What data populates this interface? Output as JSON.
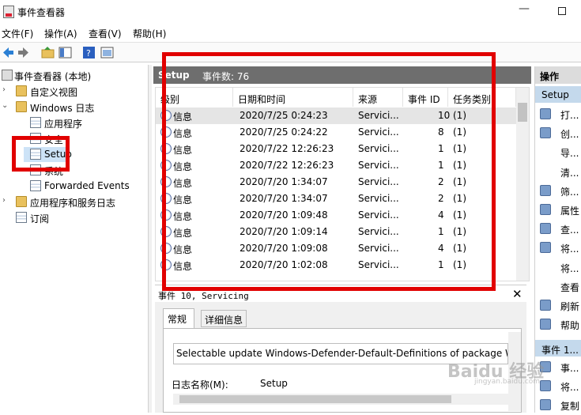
{
  "window": {
    "title": "事件查看器"
  },
  "menu": [
    "文件(F)",
    "操作(A)",
    "查看(V)",
    "帮助(H)"
  ],
  "tree": {
    "root": "事件查看器 (本地)",
    "items": [
      {
        "label": "自定义视图",
        "indent": 1
      },
      {
        "label": "Windows 日志",
        "indent": 1
      },
      {
        "label": "应用程序",
        "indent": 2
      },
      {
        "label": "安全",
        "indent": 2
      },
      {
        "label": "Setup",
        "indent": 2
      },
      {
        "label": "系统",
        "indent": 2
      },
      {
        "label": "Forwarded Events",
        "indent": 2
      },
      {
        "label": "应用程序和服务日志",
        "indent": 1
      },
      {
        "label": "订阅",
        "indent": 1
      }
    ]
  },
  "main": {
    "log_name": "Setup",
    "event_count_label": "事件数: 76",
    "columns": [
      "级别",
      "日期和时间",
      "来源",
      "事件 ID",
      "任务类别"
    ],
    "rows": [
      {
        "level": "信息",
        "datetime": "2020/7/25 0:24:23",
        "source": "Servici...",
        "event_id": "10",
        "task": "(1)"
      },
      {
        "level": "信息",
        "datetime": "2020/7/25 0:24:22",
        "source": "Servici...",
        "event_id": "8",
        "task": "(1)"
      },
      {
        "level": "信息",
        "datetime": "2020/7/22 12:26:23",
        "source": "Servici...",
        "event_id": "1",
        "task": "(1)"
      },
      {
        "level": "信息",
        "datetime": "2020/7/22 12:26:23",
        "source": "Servici...",
        "event_id": "1",
        "task": "(1)"
      },
      {
        "level": "信息",
        "datetime": "2020/7/20 1:34:07",
        "source": "Servici...",
        "event_id": "2",
        "task": "(1)"
      },
      {
        "level": "信息",
        "datetime": "2020/7/20 1:34:07",
        "source": "Servici...",
        "event_id": "2",
        "task": "(1)"
      },
      {
        "level": "信息",
        "datetime": "2020/7/20 1:09:48",
        "source": "Servici...",
        "event_id": "4",
        "task": "(1)"
      },
      {
        "level": "信息",
        "datetime": "2020/7/20 1:09:14",
        "source": "Servici...",
        "event_id": "1",
        "task": "(1)"
      },
      {
        "level": "信息",
        "datetime": "2020/7/20 1:09:08",
        "source": "Servici...",
        "event_id": "4",
        "task": "(1)"
      },
      {
        "level": "信息",
        "datetime": "2020/7/20 1:02:08",
        "source": "Servici...",
        "event_id": "1",
        "task": "(1)"
      }
    ]
  },
  "detail": {
    "title": "事件 10, Servicing",
    "tabs": [
      "常规",
      "详细信息"
    ],
    "description": "Selectable update Windows-Defender-Default-Definitions of package W",
    "log_name_label": "日志名称(M):",
    "log_name_value": "Setup"
  },
  "actions": {
    "header": "操作",
    "section1": "Setup",
    "items1": [
      {
        "label": "打...",
        "icon": "open-icon"
      },
      {
        "label": "创...",
        "icon": "filter-create-icon"
      },
      {
        "label": "导...",
        "icon": ""
      },
      {
        "label": "清...",
        "icon": ""
      },
      {
        "label": "筛...",
        "icon": "filter-icon"
      },
      {
        "label": "属性",
        "icon": "properties-icon"
      },
      {
        "label": "查...",
        "icon": "find-icon"
      },
      {
        "label": "将...",
        "icon": "save-icon"
      },
      {
        "label": "将...",
        "icon": ""
      },
      {
        "label": "查看",
        "icon": ""
      },
      {
        "label": "刷新",
        "icon": "refresh-icon"
      },
      {
        "label": "帮助",
        "icon": "help-icon"
      }
    ],
    "section2": "事件 1...",
    "items2": [
      {
        "label": "事...",
        "icon": "event-icon"
      },
      {
        "label": "将...",
        "icon": "attach-icon"
      },
      {
        "label": "复制",
        "icon": "copy-icon"
      }
    ]
  },
  "watermark": {
    "text": "Baidu 经验",
    "sub": "jingyan.baidu.com"
  },
  "colors": {
    "annotation_red": "#e10000",
    "section_blue": "#c4d9ec",
    "header_gray": "#6e6e6e"
  }
}
